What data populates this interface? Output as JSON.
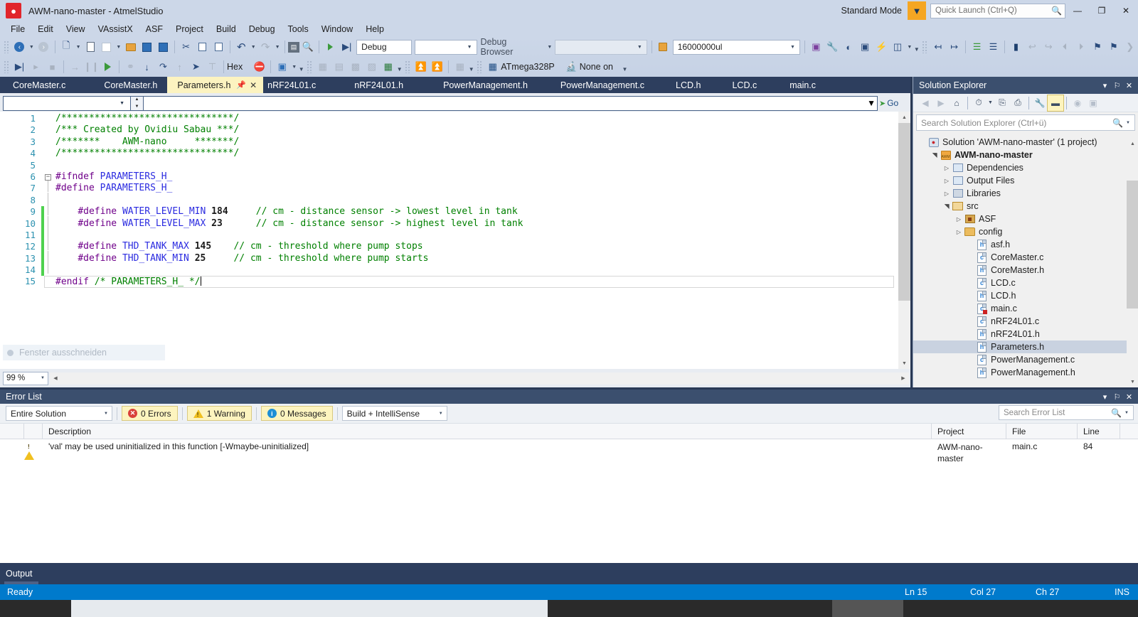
{
  "titlebar": {
    "logo_icon": "ladybug-icon",
    "title": "AWM-nano-master - AtmelStudio",
    "standard_mode": "Standard Mode",
    "mode_flag_icon": "funnel-icon",
    "quick_launch_placeholder": "Quick Launch (Ctrl+Q)",
    "search_icon": "magnifier-icon",
    "minimize": "—",
    "restore": "❐",
    "close": "✕"
  },
  "menubar": {
    "items": [
      "File",
      "Edit",
      "View",
      "VAssistX",
      "ASF",
      "Project",
      "Build",
      "Debug",
      "Tools",
      "Window",
      "Help"
    ]
  },
  "toolbar": {
    "row1": {
      "nav_back": "◀",
      "nav_forward": "▶",
      "new_project": "new-project-icon",
      "add_item": "add-item-icon",
      "new_file": "new-file-icon",
      "open_file": "open-folder-icon",
      "save": "save-icon",
      "save_all": "save-all-icon",
      "cut": "✂",
      "copy": "copy-icon",
      "paste": "paste-icon",
      "undo": "↶",
      "redo": "↷",
      "solution_explorer": "solution-explorer-icon",
      "find": "find-icon",
      "start_debugging": "▶",
      "start_without_debugging": "▶|",
      "config_value": "Debug",
      "platform_value": "",
      "debug_browser_label": "Debug Browser",
      "debug_browser_value": "",
      "device_icon": "device-icon",
      "frequency_value": "16000000ul"
    },
    "row2": {
      "continue": "▶|",
      "start_debug_break": "start-debug-break-icon",
      "stop": "■",
      "step_into_arrow": "→",
      "pause": "⏸",
      "run": "▶",
      "show_next": "show-next-statement-icon",
      "step_into": "step-into-icon",
      "step_over": "step-over-icon",
      "step_out": "step-out-icon",
      "pointer": "pointer-icon",
      "reset": "reset-icon",
      "hex_label": "Hex",
      "disable_breakpoints": "disable-all-breakpoints-icon",
      "debug_window": "debug-window-icon",
      "device_name": "ATmega328P",
      "tool_name": "None on",
      "device_chip_icon": "chip-icon",
      "tool_icon": "tool-icon"
    }
  },
  "tabs": [
    {
      "label": "CoreMaster.c",
      "active": false
    },
    {
      "label": "CoreMaster.h",
      "active": false
    },
    {
      "label": "Parameters.h",
      "active": true
    },
    {
      "label": "nRF24L01.c",
      "active": false
    },
    {
      "label": "nRF24L01.h",
      "active": false
    },
    {
      "label": "PowerManagement.h",
      "active": false
    },
    {
      "label": "PowerManagement.c",
      "active": false
    },
    {
      "label": "LCD.h",
      "active": false
    },
    {
      "label": "LCD.c",
      "active": false
    },
    {
      "label": "main.c",
      "active": false
    }
  ],
  "tab_controls": {
    "pin_icon": "pin-icon",
    "close_icon": "✕"
  },
  "editor": {
    "nav_left_value": "",
    "nav_right_value": "",
    "go_label": "Go",
    "zoom_level": "99 %",
    "snip_overlay_text": "Fenster ausschneiden",
    "lines": [
      {
        "n": "1",
        "marker": "none",
        "fold": "",
        "segments": [
          {
            "t": "/*******************************/",
            "c": "com"
          }
        ]
      },
      {
        "n": "2",
        "marker": "none",
        "fold": "",
        "segments": [
          {
            "t": "/*** Created by Ovidiu Sabau ***/",
            "c": "com"
          }
        ]
      },
      {
        "n": "3",
        "marker": "none",
        "fold": "",
        "segments": [
          {
            "t": "/*******    AWM-nano     *******/",
            "c": "com"
          }
        ]
      },
      {
        "n": "4",
        "marker": "none",
        "fold": "",
        "segments": [
          {
            "t": "/*******************************/",
            "c": "com"
          }
        ]
      },
      {
        "n": "5",
        "marker": "none",
        "fold": "",
        "segments": []
      },
      {
        "n": "6",
        "marker": "none",
        "fold": "box",
        "segments": [
          {
            "t": "#ifndef",
            "c": "pp"
          },
          {
            "t": " ",
            "c": "pl"
          },
          {
            "t": "PARAMETERS_H_",
            "c": "id"
          }
        ]
      },
      {
        "n": "7",
        "marker": "none",
        "fold": "bar",
        "segments": [
          {
            "t": "#define",
            "c": "pp"
          },
          {
            "t": " ",
            "c": "pl"
          },
          {
            "t": "PARAMETERS_H_",
            "c": "id"
          }
        ]
      },
      {
        "n": "8",
        "marker": "none",
        "fold": "bar",
        "segments": []
      },
      {
        "n": "9",
        "marker": "mod",
        "fold": "bar",
        "segments": [
          {
            "t": "    ",
            "c": "pl"
          },
          {
            "t": "#define",
            "c": "pp"
          },
          {
            "t": " ",
            "c": "pl"
          },
          {
            "t": "WATER_LEVEL_MIN",
            "c": "id"
          },
          {
            "t": " ",
            "c": "pl"
          },
          {
            "t": "184",
            "c": "num"
          },
          {
            "t": "     ",
            "c": "pl"
          },
          {
            "t": "// cm - distance sensor -> lowest level in tank",
            "c": "com"
          }
        ]
      },
      {
        "n": "10",
        "marker": "mod",
        "fold": "bar",
        "segments": [
          {
            "t": "    ",
            "c": "pl"
          },
          {
            "t": "#define",
            "c": "pp"
          },
          {
            "t": " ",
            "c": "pl"
          },
          {
            "t": "WATER_LEVEL_MAX",
            "c": "id"
          },
          {
            "t": " ",
            "c": "pl"
          },
          {
            "t": "23",
            "c": "num"
          },
          {
            "t": "      ",
            "c": "pl"
          },
          {
            "t": "// cm - distance sensor -> highest level in tank",
            "c": "com"
          }
        ]
      },
      {
        "n": "11",
        "marker": "mod",
        "fold": "bar",
        "segments": []
      },
      {
        "n": "12",
        "marker": "mod",
        "fold": "bar",
        "segments": [
          {
            "t": "    ",
            "c": "pl"
          },
          {
            "t": "#define",
            "c": "pp"
          },
          {
            "t": " ",
            "c": "pl"
          },
          {
            "t": "THD_TANK_MAX",
            "c": "id"
          },
          {
            "t": " ",
            "c": "pl"
          },
          {
            "t": "145",
            "c": "num"
          },
          {
            "t": "    ",
            "c": "pl"
          },
          {
            "t": "// cm - threshold where pump stops",
            "c": "com"
          }
        ]
      },
      {
        "n": "13",
        "marker": "mod",
        "fold": "bar",
        "segments": [
          {
            "t": "    ",
            "c": "pl"
          },
          {
            "t": "#define",
            "c": "pp"
          },
          {
            "t": " ",
            "c": "pl"
          },
          {
            "t": "THD_TANK_MIN",
            "c": "id"
          },
          {
            "t": " ",
            "c": "pl"
          },
          {
            "t": "25",
            "c": "num"
          },
          {
            "t": "     ",
            "c": "pl"
          },
          {
            "t": "// cm - threshold where pump starts",
            "c": "com"
          }
        ]
      },
      {
        "n": "14",
        "marker": "mod",
        "fold": "bar",
        "segments": []
      },
      {
        "n": "15",
        "marker": "none",
        "fold": "",
        "segments": [
          {
            "t": "#endif",
            "c": "pp"
          },
          {
            "t": " ",
            "c": "pl"
          },
          {
            "t": "/* PARAMETERS_H_ */",
            "c": "com"
          }
        ],
        "caret": true
      }
    ]
  },
  "solution_explorer": {
    "title": "Solution Explorer",
    "header_buttons": [
      "▾",
      "⚐",
      "✕"
    ],
    "toolbar": {
      "back": "◀",
      "forward": "▶",
      "home": "⌂",
      "pending_changes": "pending-changes-icon",
      "sync": "sync-with-active-document-icon",
      "refresh": "refresh-icon",
      "show_all_files": "show-all-files-icon",
      "properties": "properties-icon",
      "preview": "preview-selected-items-icon",
      "class_view": "class-view-icon"
    },
    "search_placeholder": "Search Solution Explorer (Ctrl+ü)",
    "search_icon": "magnifier-icon",
    "tree": [
      {
        "label": "Solution 'AWM-nano-master' (1 project)",
        "indent": 0,
        "twisty": "none",
        "icon": "solution-icon",
        "bold": false,
        "selected": false
      },
      {
        "label": "AWM-nano-master",
        "indent": 1,
        "twisty": "open",
        "icon": "project-icon",
        "bold": true,
        "selected": false
      },
      {
        "label": "Dependencies",
        "indent": 2,
        "twisty": "closed",
        "icon": "references-icon",
        "bold": false,
        "selected": false
      },
      {
        "label": "Output Files",
        "indent": 2,
        "twisty": "closed",
        "icon": "references-icon",
        "bold": false,
        "selected": false
      },
      {
        "label": "Libraries",
        "indent": 2,
        "twisty": "closed",
        "icon": "libraries-icon",
        "bold": false,
        "selected": false
      },
      {
        "label": "src",
        "indent": 2,
        "twisty": "open",
        "icon": "folder-open-icon",
        "bold": false,
        "selected": false
      },
      {
        "label": "ASF",
        "indent": 3,
        "twisty": "closed",
        "icon": "asf-folder-icon",
        "bold": false,
        "selected": false
      },
      {
        "label": "config",
        "indent": 3,
        "twisty": "closed",
        "icon": "folder-icon",
        "bold": false,
        "selected": false
      },
      {
        "label": "asf.h",
        "indent": 4,
        "twisty": "none",
        "icon": "h-file-icon",
        "bold": false,
        "selected": false
      },
      {
        "label": "CoreMaster.c",
        "indent": 4,
        "twisty": "none",
        "icon": "c-file-icon",
        "bold": false,
        "selected": false
      },
      {
        "label": "CoreMaster.h",
        "indent": 4,
        "twisty": "none",
        "icon": "h-file-icon",
        "bold": false,
        "selected": false
      },
      {
        "label": "LCD.c",
        "indent": 4,
        "twisty": "none",
        "icon": "c-file-icon",
        "bold": false,
        "selected": false
      },
      {
        "label": "LCD.h",
        "indent": 4,
        "twisty": "none",
        "icon": "h-file-icon",
        "bold": false,
        "selected": false
      },
      {
        "label": "main.c",
        "indent": 4,
        "twisty": "none",
        "icon": "c-file-error-icon",
        "bold": false,
        "selected": false
      },
      {
        "label": "nRF24L01.c",
        "indent": 4,
        "twisty": "none",
        "icon": "c-file-icon",
        "bold": false,
        "selected": false
      },
      {
        "label": "nRF24L01.h",
        "indent": 4,
        "twisty": "none",
        "icon": "h-file-icon",
        "bold": false,
        "selected": false
      },
      {
        "label": "Parameters.h",
        "indent": 4,
        "twisty": "none",
        "icon": "h-file-icon",
        "bold": false,
        "selected": true
      },
      {
        "label": "PowerManagement.c",
        "indent": 4,
        "twisty": "none",
        "icon": "c-file-icon",
        "bold": false,
        "selected": false
      },
      {
        "label": "PowerManagement.h",
        "indent": 4,
        "twisty": "none",
        "icon": "h-file-icon",
        "bold": false,
        "selected": false
      }
    ]
  },
  "error_list": {
    "title": "Error List",
    "header_buttons": [
      "▾",
      "⚐",
      "✕"
    ],
    "scope_value": "Entire Solution",
    "errors_count": "0 Errors",
    "warnings_count": "1 Warning",
    "messages_count": "0 Messages",
    "filter_value": "Build + IntelliSense",
    "search_placeholder": "Search Error List",
    "search_icon": "magnifier-icon",
    "columns": [
      "",
      "",
      "Description",
      "Project",
      "File",
      "Line"
    ],
    "rows": [
      {
        "severity": "warning",
        "description": "'val' may be used uninitialized in this function [-Wmaybe-uninitialized]",
        "project": "AWM-nano-master",
        "file": "main.c",
        "line": "84"
      }
    ]
  },
  "output_panel": {
    "title": "Output"
  },
  "statusbar": {
    "ready": "Ready",
    "line": "Ln 15",
    "column": "Col 27",
    "character": "Ch 27",
    "insert_mode": "INS"
  },
  "colors": {
    "accent_blue": "#007acc",
    "chrome": "#ccd7e8",
    "panel_header": "#3b4f6e",
    "active_tab": "#fcf3c0",
    "comment_green": "#008000",
    "preprocessor_purple": "#6f008a",
    "identifier_blue": "#2b2be0"
  }
}
